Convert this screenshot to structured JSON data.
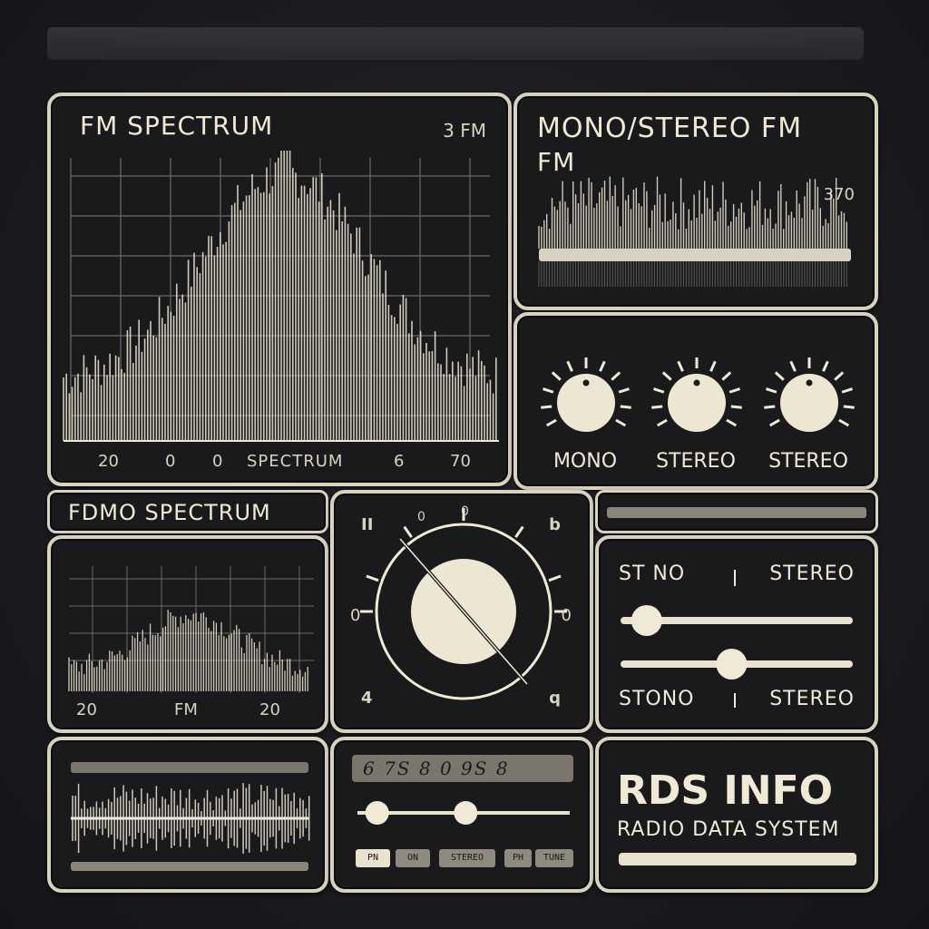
{
  "spectrum_panel": {
    "title": "FM SPECTRUM",
    "corner_label": "3 FM",
    "axis_labels": [
      "20",
      "0",
      "0",
      "SPECTRUM",
      "6",
      "70"
    ]
  },
  "mono_stereo_panel": {
    "title_line1": "MONO/STEREO FM",
    "title_line2": "FM",
    "corner_value": "370"
  },
  "knobs_panel": {
    "knobs": [
      {
        "label": "MONO"
      },
      {
        "label": "STEREO"
      },
      {
        "label": "STEREO"
      }
    ]
  },
  "fdmo_panel": {
    "header": "FDMO SPECTRUM",
    "axis_left": "20",
    "axis_center": "FM",
    "axis_right": "20"
  },
  "tuner_panel": {
    "top_left_icon": "II",
    "top_right_icon": "b",
    "bottom_left_icon": "4",
    "bottom_right_icon": "q",
    "left_scale": "0",
    "right_scale": "0",
    "tick_labels": [
      "0",
      "0"
    ]
  },
  "slider_panel": {
    "header_top_left": "ST NO",
    "header_top_right": "STEREO",
    "footer_left": "STONO",
    "footer_right": "STEREO",
    "slider1_value": 0.05,
    "slider2_value": 0.4
  },
  "waveform_panel": {},
  "controls_panel": {
    "display": "6 7S 8 0 9S 8",
    "slider1_value": 0.05,
    "slider2_value": 0.45,
    "buttons": [
      "PN",
      "ON",
      "STEREO",
      "PH",
      "TUNE"
    ]
  },
  "rds_panel": {
    "title": "RDS INFO",
    "subtitle": "RADIO DATA SYSTEM"
  },
  "colors": {
    "background": "#1c1b20",
    "panel_border": "#d8d2c0",
    "accent": "#efe9d6"
  }
}
